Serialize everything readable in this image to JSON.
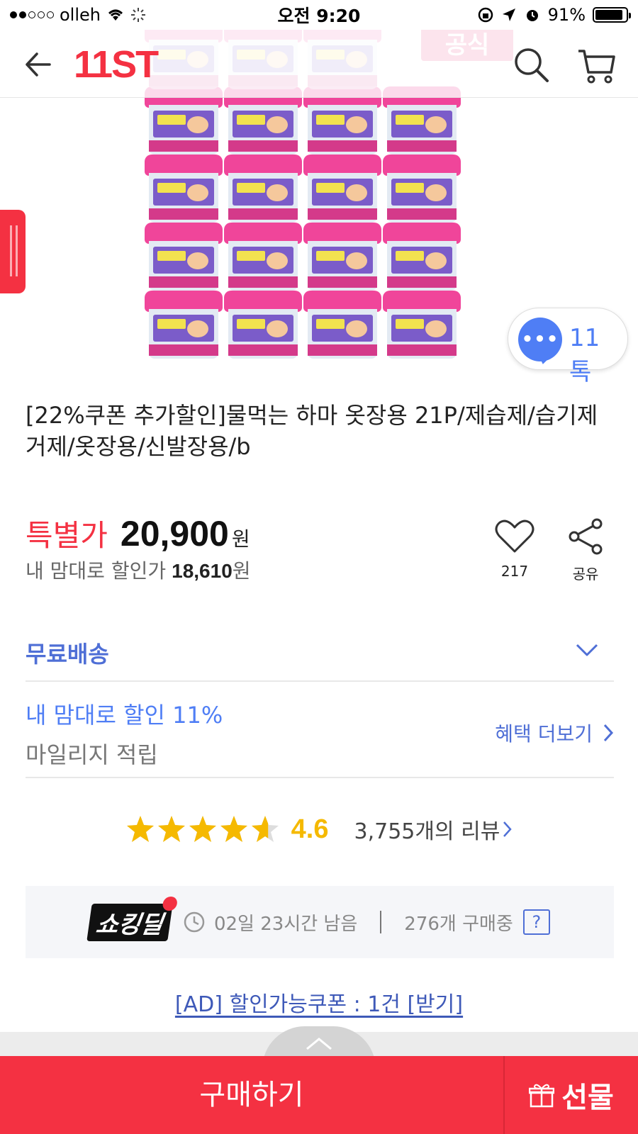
{
  "status_bar": {
    "carrier": "olleh",
    "time": "오전 9:20",
    "battery": "91%"
  },
  "header": {
    "logo": "11ST"
  },
  "product": {
    "badge": "공식",
    "title": " [22%쿠폰 추가할인]물먹는 하마 옷장용 21P/제습제/습기제거제/옷장용/신발장용/b",
    "price_label": "특별가",
    "price": "20,900",
    "currency": "원",
    "discount_label": "내 맘대로 할인가",
    "discount_price": "18,610",
    "discount_currency": "원",
    "likes": "217",
    "share_label": "공유"
  },
  "talk": {
    "dots": "•••",
    "label": "11 톡"
  },
  "shipping": {
    "label": "무료배송"
  },
  "benefits": {
    "discount": "내 맘대로 할인 11%",
    "mileage": "마일리지 적립",
    "more": "혜택 더보기"
  },
  "rating": {
    "value": "4.6",
    "score": 4.6,
    "max": 5,
    "reviews": "3,755개의 리뷰"
  },
  "deal": {
    "logo": "쇼킹딜",
    "time_left": "02일 23시간 남음",
    "buyers": "276개 구매중",
    "help": "?"
  },
  "coupon": {
    "text": "[AD] 할인가능쿠폰 : 1건 [받기]"
  },
  "actions": {
    "buy": "구매하기",
    "gift": "선물"
  },
  "colors": {
    "brand_red": "#f43142",
    "link_blue": "#4f6fd6",
    "star_yellow": "#f5b900"
  }
}
